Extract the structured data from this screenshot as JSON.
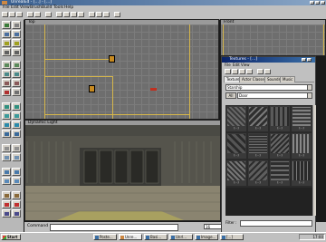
{
  "window": {
    "title": "UnrealEd - [...] - [...]"
  },
  "menu": {
    "items": [
      "File",
      "Edit",
      "View",
      "Brush",
      "Build",
      "Tools",
      "Help"
    ]
  },
  "viewports": {
    "top": {
      "label": "Top"
    },
    "front": {
      "label": "Front"
    },
    "dynamic": {
      "label": "Dynamic Light"
    }
  },
  "texture_browser": {
    "title": "Textures - [...]",
    "menu": [
      "File",
      "Edit",
      "View"
    ],
    "tabs": [
      "Textures",
      "Actor Classes",
      "Sounds",
      "Music"
    ],
    "package": "Starship",
    "all_label": "All",
    "group": "Door",
    "thumbnails": [
      "[...]",
      "[...]",
      "[...]",
      "[...]",
      "[...]",
      "[...]",
      "[...]",
      "[...]",
      "[...]",
      "[...]",
      "[...]",
      "[...]"
    ],
    "filter_label": "Filter :",
    "filter_value": ""
  },
  "bottom_bar": {
    "command_label": "Command",
    "command_value": "",
    "grid_value": "16"
  },
  "taskbar": {
    "start_label": "Start",
    "tasks": [
      "Poste...",
      "Unre...",
      "Basi...",
      "Unrl...",
      "Image...",
      "[...]"
    ],
    "clock": "17:00"
  }
}
